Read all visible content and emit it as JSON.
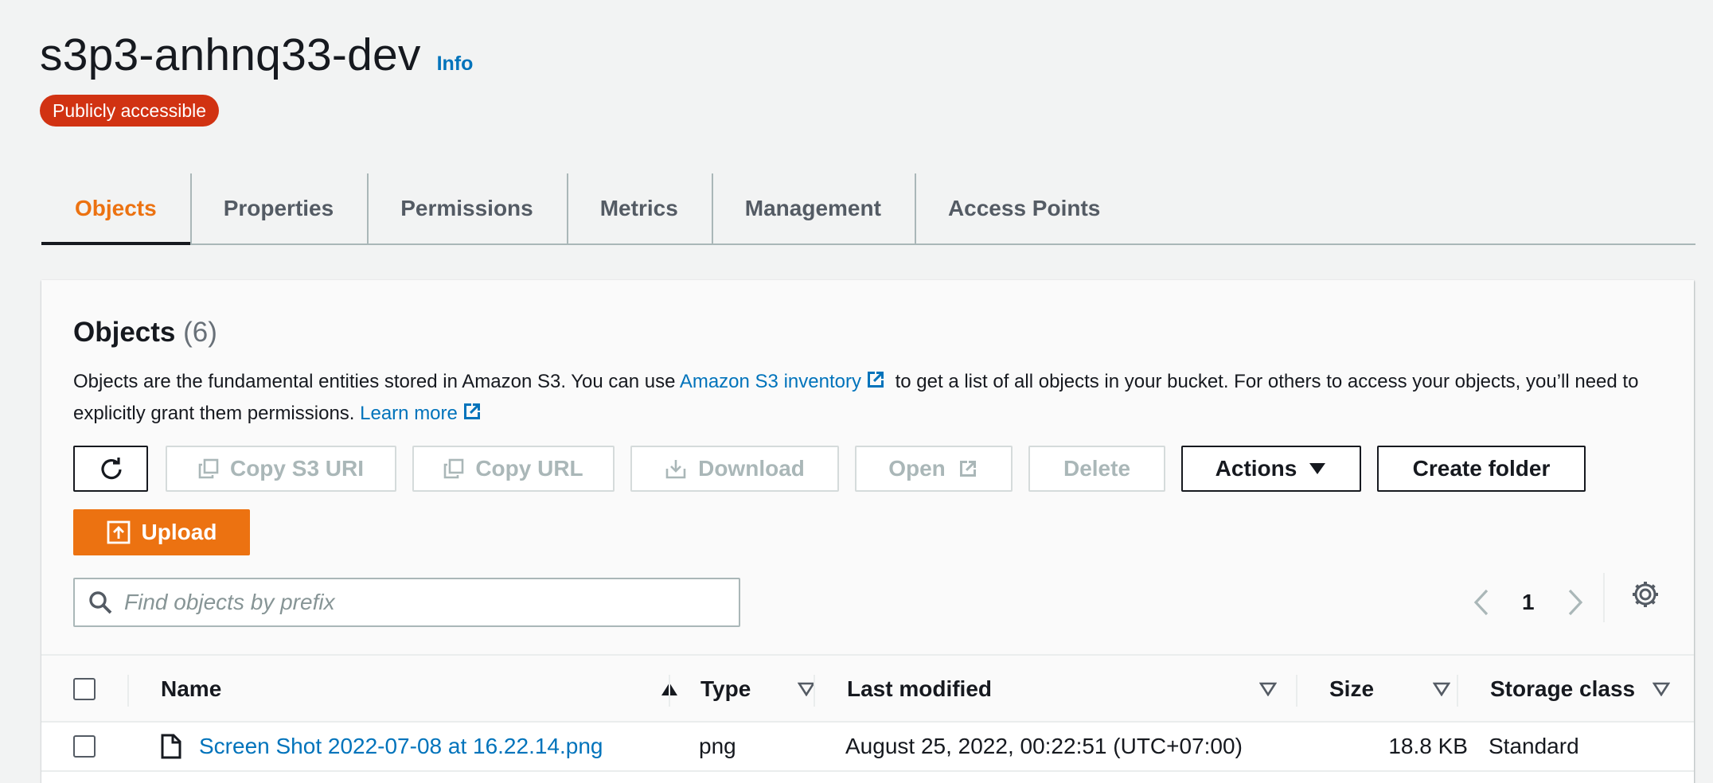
{
  "header": {
    "bucket_name": "s3p3-anhnq33-dev",
    "info_label": "Info",
    "badge": "Publicly accessible"
  },
  "tabs": [
    {
      "label": "Objects",
      "active": true
    },
    {
      "label": "Properties"
    },
    {
      "label": "Permissions"
    },
    {
      "label": "Metrics"
    },
    {
      "label": "Management"
    },
    {
      "label": "Access Points"
    }
  ],
  "objects_panel": {
    "heading": "Objects",
    "count": "(6)",
    "desc_part1": "Objects are the fundamental entities stored in Amazon S3. You can use ",
    "inventory_link": "Amazon S3 inventory",
    "desc_part2": " to get a list of all objects in your bucket. For others to access your objects, you’ll need to explicitly grant them permissions. ",
    "learn_more": "Learn more"
  },
  "toolbar": {
    "copy_s3_uri": "Copy S3 URI",
    "copy_url": "Copy URL",
    "download": "Download",
    "open": "Open",
    "delete": "Delete",
    "actions": "Actions",
    "create_folder": "Create folder",
    "upload": "Upload"
  },
  "search": {
    "placeholder": "Find objects by prefix",
    "value": ""
  },
  "pagination": {
    "current_page": "1"
  },
  "table": {
    "columns": {
      "name": "Name",
      "type": "Type",
      "last_modified": "Last modified",
      "size": "Size",
      "storage_class": "Storage class"
    },
    "rows": [
      {
        "name": "Screen Shot 2022-07-08 at 16.22.14.png",
        "type": "png",
        "last_modified": "August 25, 2022, 00:22:51 (UTC+07:00)",
        "size": "18.8 KB",
        "storage_class": "Standard"
      }
    ]
  },
  "colors": {
    "accent_orange": "#ec7211",
    "link_blue": "#0073bb",
    "badge_red": "#d13212",
    "page_bg": "#f2f3f3"
  }
}
